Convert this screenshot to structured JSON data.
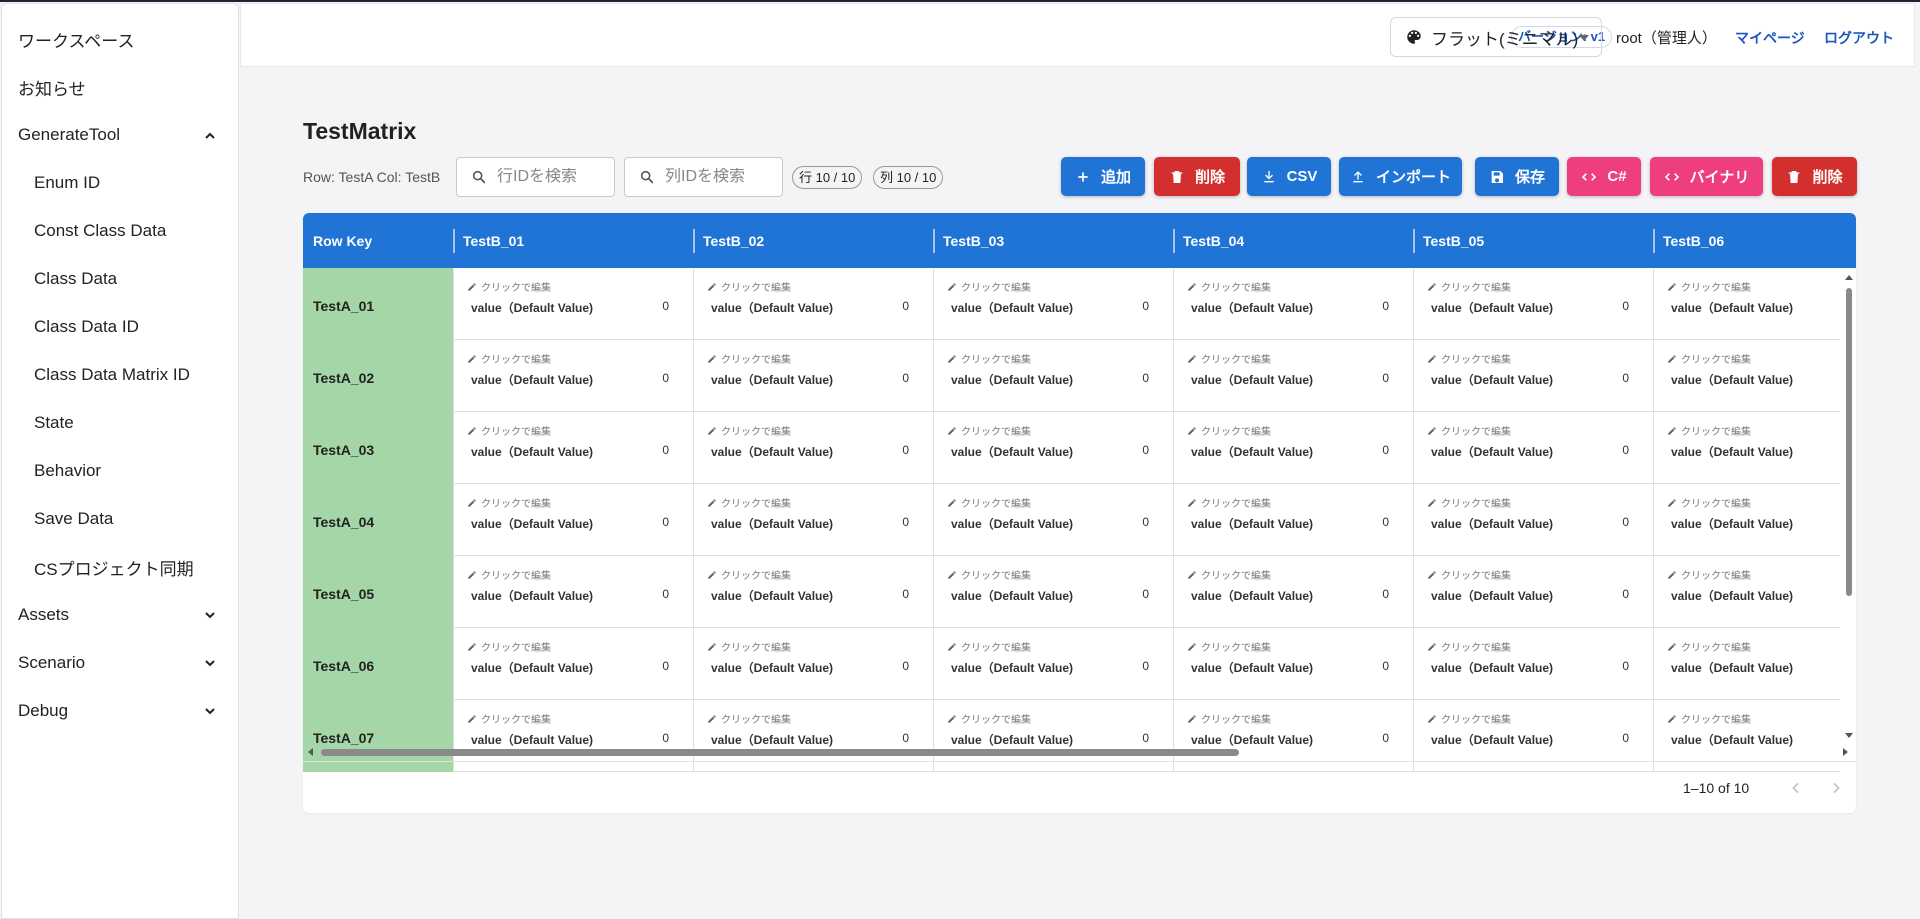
{
  "sidebar": {
    "items": [
      {
        "label": "ワークスペース",
        "level": "top"
      },
      {
        "label": "お知らせ",
        "level": "top"
      },
      {
        "label": "GenerateTool",
        "level": "top",
        "chevron": "up"
      },
      {
        "label": "Enum ID",
        "level": "sub"
      },
      {
        "label": "Const Class Data",
        "level": "sub"
      },
      {
        "label": "Class Data",
        "level": "sub"
      },
      {
        "label": "Class Data ID",
        "level": "sub"
      },
      {
        "label": "Class Data Matrix ID",
        "level": "sub"
      },
      {
        "label": "State",
        "level": "sub"
      },
      {
        "label": "Behavior",
        "level": "sub"
      },
      {
        "label": "Save Data",
        "level": "sub"
      },
      {
        "label": "CSプロジェクト同期",
        "level": "sub"
      },
      {
        "label": "Assets",
        "level": "top",
        "chevron": "down"
      },
      {
        "label": "Scenario",
        "level": "top",
        "chevron": "down"
      },
      {
        "label": "Debug",
        "level": "top",
        "chevron": "down"
      }
    ]
  },
  "header": {
    "version_badge": "バージョン: v1",
    "theme_select": {
      "value": "フラット(ミニマル)",
      "icon": "palette-icon"
    },
    "user": "root（管理人）",
    "mypage_link": "マイページ",
    "logout_link": "ログアウト"
  },
  "page": {
    "title": "TestMatrix",
    "rowcol_label": "Row: TestA  Col: TestB",
    "row_search_placeholder": "行IDを検索",
    "col_search_placeholder": "列IDを検索",
    "row_count": "行 10 / 10",
    "col_count": "列 10 / 10"
  },
  "toolbar": {
    "buttons": [
      {
        "label": "追加",
        "icon": "plus-icon",
        "color": "#1f74d6"
      },
      {
        "label": "削除",
        "icon": "trash-icon",
        "color": "#d32f2f"
      },
      {
        "label": "CSV",
        "icon": "download-icon",
        "color": "#1f74d6"
      },
      {
        "label": "インポート",
        "icon": "upload-icon",
        "color": "#1f74d6"
      },
      {
        "label": "保存",
        "icon": "save-icon",
        "color": "#1f74d6"
      },
      {
        "label": "C#",
        "icon": "code-icon",
        "color": "#ef3e7e"
      },
      {
        "label": "バイナリ",
        "icon": "code-icon",
        "color": "#ef3e7e"
      },
      {
        "label": "削除",
        "icon": "trash-icon",
        "color": "#d32f2f"
      }
    ]
  },
  "table": {
    "header_color": "#1f74d6",
    "rowkey_color": "#a5d6a7",
    "columns": [
      "Row Key",
      "TestB_01",
      "TestB_02",
      "TestB_03",
      "TestB_04",
      "TestB_05",
      "TestB_06"
    ],
    "cell_hint": "クリックで編集",
    "cell_label": "value（Default Value)",
    "rows": [
      {
        "key": "TestA_01",
        "values": [
          "0",
          "0",
          "0",
          "0",
          "0",
          "0"
        ]
      },
      {
        "key": "TestA_02",
        "values": [
          "0",
          "0",
          "0",
          "0",
          "0",
          "0"
        ]
      },
      {
        "key": "TestA_03",
        "values": [
          "0",
          "0",
          "0",
          "0",
          "0",
          "0"
        ]
      },
      {
        "key": "TestA_04",
        "values": [
          "0",
          "0",
          "0",
          "0",
          "0",
          "0"
        ]
      },
      {
        "key": "TestA_05",
        "values": [
          "0",
          "0",
          "0",
          "0",
          "0",
          "0"
        ]
      },
      {
        "key": "TestA_06",
        "values": [
          "0",
          "0",
          "0",
          "0",
          "0",
          "0"
        ]
      },
      {
        "key": "TestA_07",
        "values": [
          "0",
          "0",
          "0",
          "0",
          "0",
          "0"
        ]
      }
    ],
    "pagination": "1–10 of 10"
  }
}
